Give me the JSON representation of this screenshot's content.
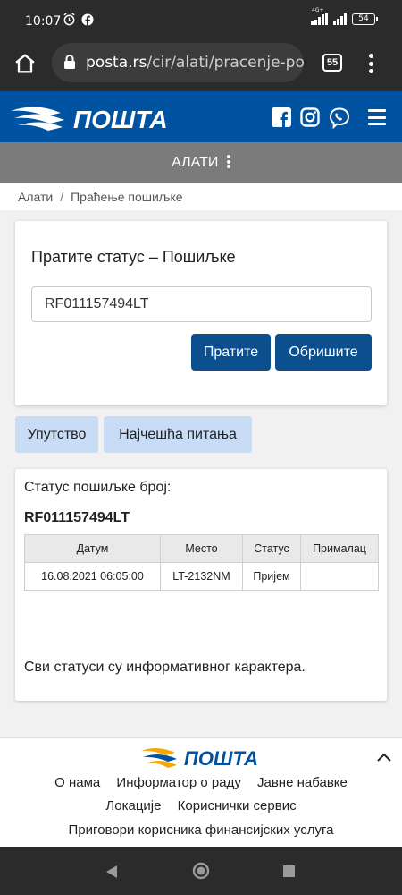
{
  "status_bar": {
    "time": "10:07",
    "network": "4G+",
    "battery": "54",
    "icons": [
      "alarm-icon",
      "facebook-notification-icon",
      "signal-icon",
      "battery-icon"
    ]
  },
  "browser": {
    "url_domain": "posta.rs",
    "url_path": "/cir/alati/pracenje-po",
    "tab_count": "55"
  },
  "header": {
    "logo_text": "ПОШТА",
    "social_icons": [
      "facebook-icon",
      "instagram-icon",
      "viber-icon"
    ],
    "menu_icon": "hamburger-icon",
    "brand_color": "#0053a0",
    "logo_accent": "#f5a800"
  },
  "toolbar": {
    "label": "АЛАТИ"
  },
  "breadcrumb": {
    "items": [
      "Алати",
      "Праћење пошиљке"
    ],
    "separator": "/"
  },
  "tracking_form": {
    "title": "Пратите статус – Пошиљке",
    "input_value": "RF011157494LT",
    "track_button": "Пратите",
    "clear_button": "Обришите"
  },
  "links": {
    "instructions": "Упутство",
    "faq": "Најчешћа питања"
  },
  "result": {
    "label": "Статус пошиљке број:",
    "number": "RF011157494LT",
    "columns": [
      "Датум",
      "Место",
      "Статус",
      "Прималац"
    ],
    "rows": [
      {
        "date": "16.08.2021 06:05:00",
        "place": "LT-2132NM",
        "status": "Пријем",
        "recipient": ""
      }
    ],
    "note": "Сви статуси су информативног карактера."
  },
  "footer": {
    "logo_text": "ПОШТА",
    "row1": [
      "О нама",
      "Информатор о раду",
      "Јавне набавке"
    ],
    "row2": [
      "Локације",
      "Кориснички сервис"
    ],
    "row3": [
      "Приговори корисника финансијских услуга"
    ]
  }
}
